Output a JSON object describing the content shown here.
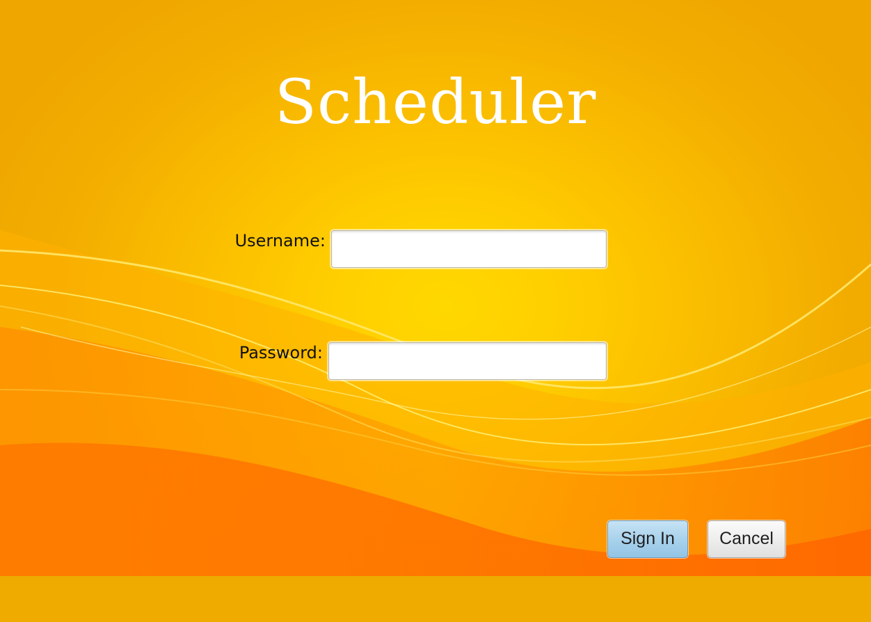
{
  "app": {
    "title": "Scheduler"
  },
  "login_form": {
    "username_label": "Username:",
    "username_value": "",
    "password_label": "Password:",
    "password_value": ""
  },
  "actions": {
    "sign_in_label": "Sign In",
    "cancel_label": "Cancel"
  },
  "theme": {
    "background_main": "#ffcf00",
    "background_edge": "#efa700",
    "wave_orange": "#ff7a00",
    "title_color": "#ffffff",
    "primary_button": "#a9d2ec"
  }
}
